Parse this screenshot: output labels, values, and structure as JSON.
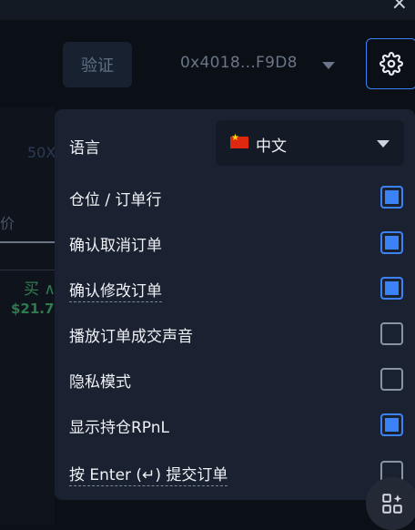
{
  "header": {
    "close_icon": "×",
    "verify_label": "验证",
    "wallet_address": "0x4018...F9D8"
  },
  "background": {
    "leverage": "50X",
    "price_col": "价",
    "buy_label": "买 ∧",
    "buy_price": "$21.7"
  },
  "settings": {
    "language_label": "语言",
    "language_value": "中文",
    "options": [
      {
        "label": "仓位 / 订单行",
        "checked": true,
        "dashed": false
      },
      {
        "label": "确认取消订单",
        "checked": true,
        "dashed": false
      },
      {
        "label": "确认修改订单",
        "checked": true,
        "dashed": true
      },
      {
        "label": "播放订单成交声音",
        "checked": false,
        "dashed": false
      },
      {
        "label": "隐私模式",
        "checked": false,
        "dashed": false
      },
      {
        "label": "显示持仓RPnL",
        "checked": true,
        "dashed": false
      },
      {
        "label": "按 Enter (↵) 提交订单",
        "checked": false,
        "dashed": true
      }
    ]
  },
  "colors": {
    "accent": "#3b82f6",
    "panel": "#1a2130",
    "background": "#0b0f16",
    "buy_green": "#2f7a4f"
  },
  "icons": {
    "close": "close-icon",
    "caret": "chevron-down-icon",
    "settings": "gear-icon",
    "flag": "china-flag-icon",
    "widgets": "widgets-sparkle-icon"
  }
}
